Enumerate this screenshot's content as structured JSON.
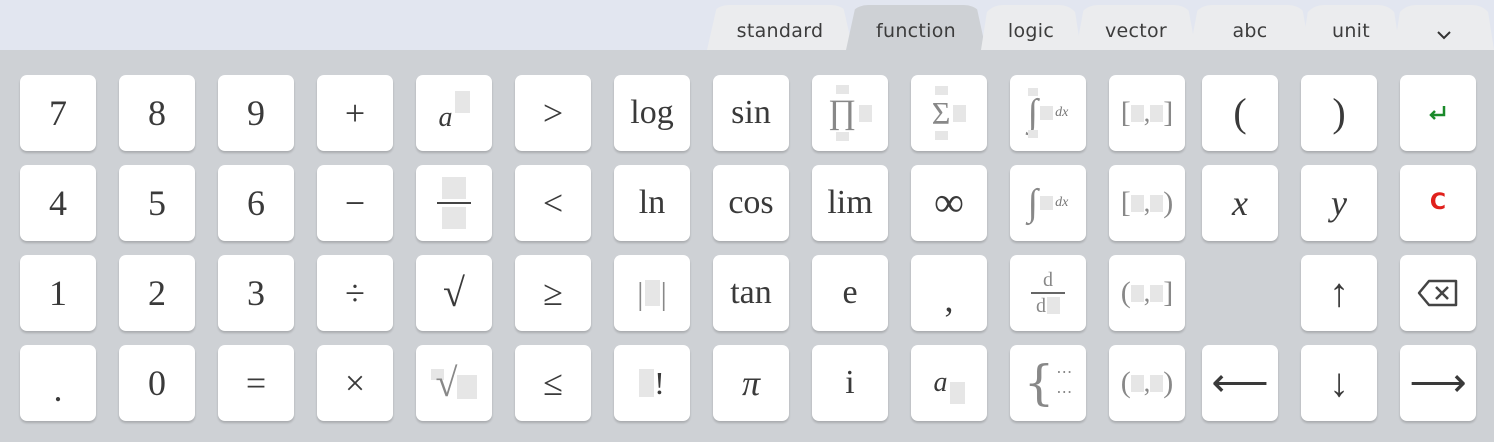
{
  "tabs": [
    {
      "label": "standard",
      "active": false
    },
    {
      "label": "function",
      "active": true
    },
    {
      "label": "logic",
      "active": false
    },
    {
      "label": "vector",
      "active": false
    },
    {
      "label": "abc",
      "active": false
    },
    {
      "label": "unit",
      "active": false
    }
  ],
  "tabs_more_icon": "chevron-down-icon",
  "keys": {
    "k7": "7",
    "k8": "8",
    "k9": "9",
    "plus": "+",
    "power_base": "a",
    "gt": ">",
    "log": "log",
    "sin": "sin",
    "sum_sigma": "Σ",
    "product_pi": "∏",
    "integral_dx": "dx",
    "lbracket": "[",
    "rbracket": "]",
    "comma_sep": ",",
    "lparen": "(",
    "rparen": ")",
    "enter_icon": "enter-icon",
    "k4": "4",
    "k5": "5",
    "k6": "6",
    "minus": "−",
    "lt": "<",
    "ln": "ln",
    "cos": "cos",
    "lim": "lim",
    "infinity": "∞",
    "interval_rparen": ")",
    "x": "x",
    "y": "y",
    "clear": "C",
    "k1": "1",
    "k2": "2",
    "k3": "3",
    "divide": "÷",
    "sqrt": "√",
    "geq": "≥",
    "abs_bar": "|",
    "tan": "tan",
    "e": "e",
    "comma": ",",
    "deriv_d": "d",
    "interval_lparen": "(",
    "up_arrow": "↑",
    "backspace_icon": "backspace-icon",
    "dot": ".",
    "k0": "0",
    "equals": "=",
    "times": "×",
    "nthroot": "√",
    "leq": "≤",
    "factorial": "!",
    "pi": "π",
    "i": "i",
    "subscript_base": "a",
    "cases_dots": "⋯",
    "left_arrow": "⟵",
    "down_arrow": "↓",
    "right_arrow": "⟶"
  },
  "colors": {
    "enter": "#1a8a2a",
    "clear": "#e0201c",
    "key_text": "#3a3a3a"
  }
}
